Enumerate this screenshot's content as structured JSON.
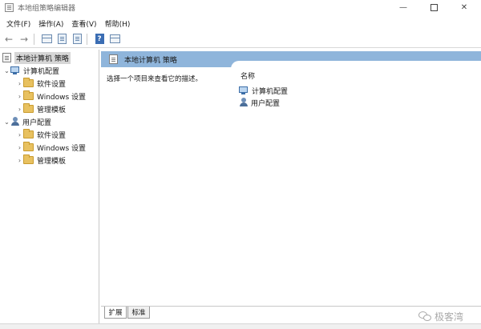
{
  "window": {
    "title": "本地组策略编辑器"
  },
  "menu": [
    {
      "label": "文件(F)"
    },
    {
      "label": "操作(A)"
    },
    {
      "label": "查看(V)"
    },
    {
      "label": "帮助(H)"
    }
  ],
  "tree": {
    "root": "本地计算机 策略",
    "computer": {
      "label": "计算机配置",
      "children": [
        {
          "label": "软件设置"
        },
        {
          "label": "Windows 设置"
        },
        {
          "label": "管理模板"
        }
      ]
    },
    "user": {
      "label": "用户配置",
      "children": [
        {
          "label": "软件设置"
        },
        {
          "label": "Windows 设置"
        },
        {
          "label": "管理模板"
        }
      ]
    }
  },
  "content": {
    "header_title": "本地计算机 策略",
    "description": "选择一个项目来查看它的描述。",
    "column_name": "名称",
    "items": [
      {
        "label": "计算机配置"
      },
      {
        "label": "用户配置"
      }
    ]
  },
  "tabs": [
    {
      "label": "扩展"
    },
    {
      "label": "标准"
    }
  ],
  "watermark": {
    "text": "极客湾"
  }
}
